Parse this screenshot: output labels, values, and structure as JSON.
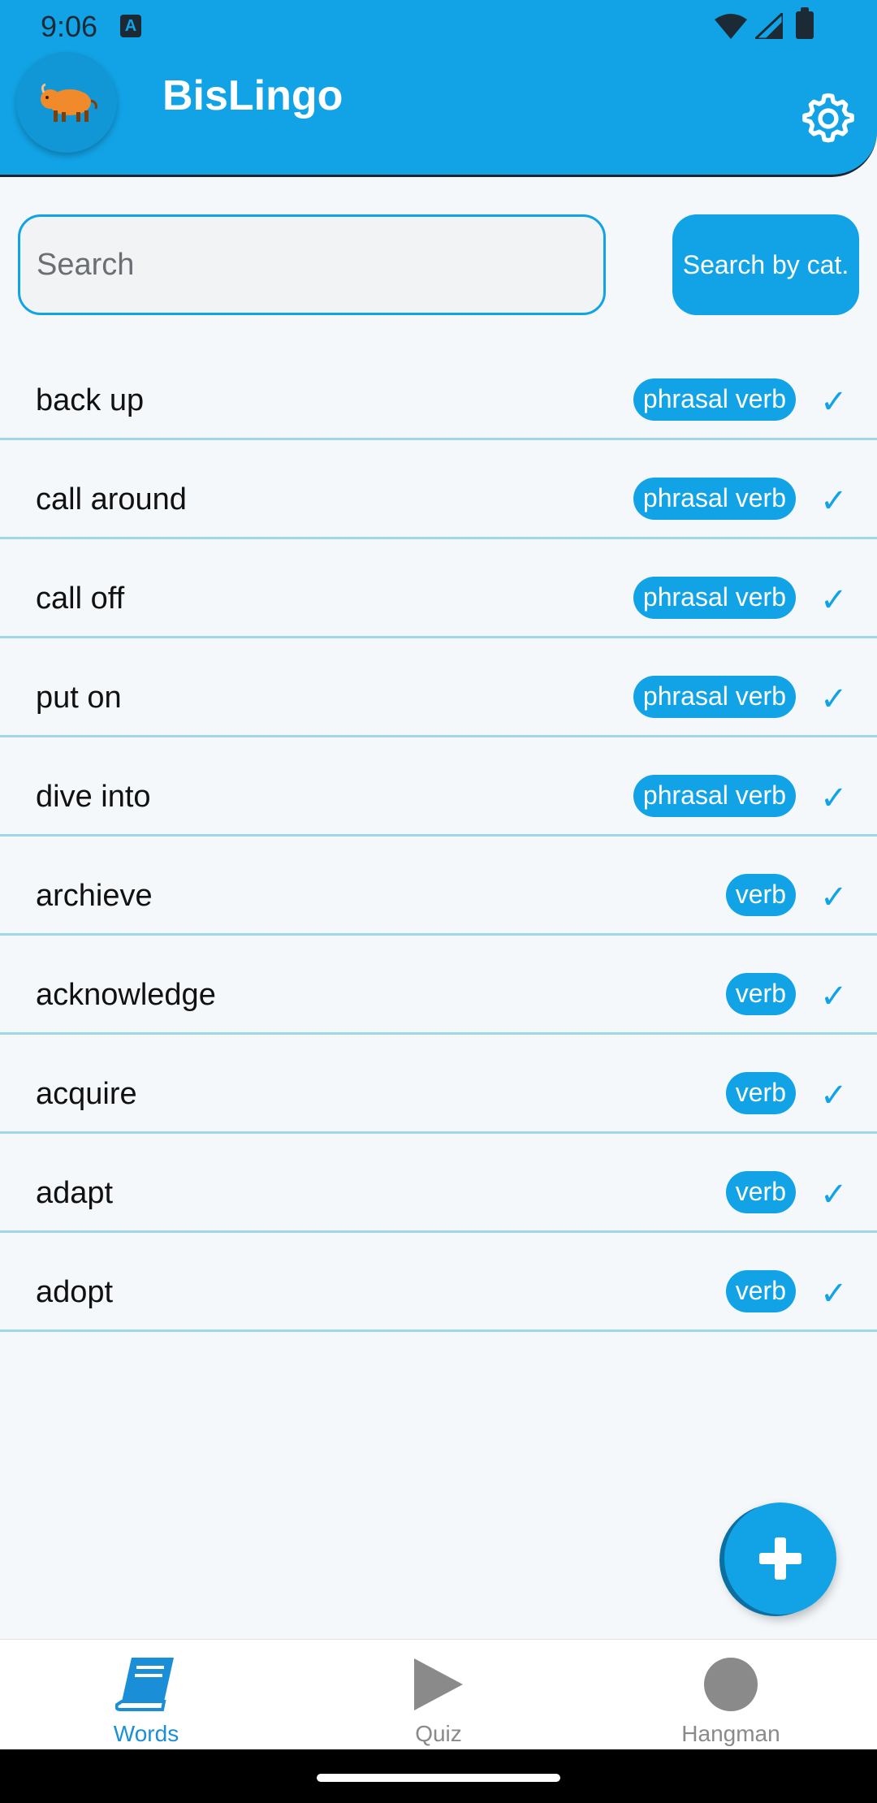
{
  "status_bar": {
    "time": "9:06",
    "notification_icon": "A"
  },
  "header": {
    "title": "BisLingo",
    "logo_icon": "bison-icon",
    "settings_icon": "gear-icon"
  },
  "search": {
    "placeholder": "Search",
    "value": "",
    "category_button_label": "Search by cat."
  },
  "words": [
    {
      "word": "back up",
      "category": "phrasal verb"
    },
    {
      "word": "call around",
      "category": "phrasal verb"
    },
    {
      "word": "call off",
      "category": "phrasal verb"
    },
    {
      "word": "put on",
      "category": "phrasal verb"
    },
    {
      "word": "dive into",
      "category": "phrasal verb"
    },
    {
      "word": "archieve",
      "category": "verb"
    },
    {
      "word": "acknowledge",
      "category": "verb"
    },
    {
      "word": "acquire",
      "category": "verb"
    },
    {
      "word": "adapt",
      "category": "verb"
    },
    {
      "word": "adopt",
      "category": "verb"
    }
  ],
  "check_mark": "✓",
  "fab": {
    "icon": "plus-icon"
  },
  "bottom_nav": {
    "items": [
      {
        "label": "Words",
        "icon": "book-icon",
        "active": true
      },
      {
        "label": "Quiz",
        "icon": "play-icon",
        "active": false
      },
      {
        "label": "Hangman",
        "icon": "circle-icon",
        "active": false
      }
    ]
  },
  "colors": {
    "primary": "#12a3e6",
    "background": "#f4f8fb",
    "divider": "#9fd6ea",
    "nav_active": "#1a8fd8",
    "nav_inactive": "#8a8a8a"
  }
}
